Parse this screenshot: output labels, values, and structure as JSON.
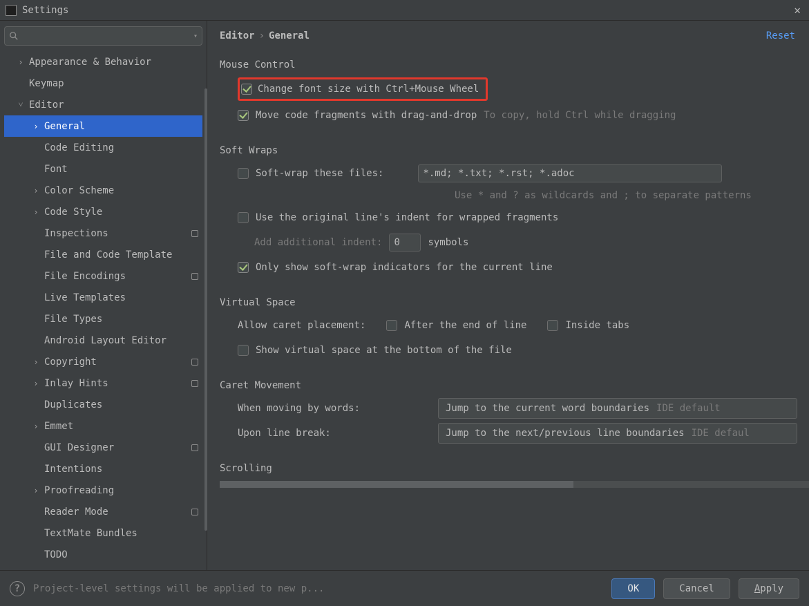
{
  "window": {
    "title": "Settings"
  },
  "search": {
    "placeholder": ""
  },
  "sidebar": {
    "items": [
      {
        "label": "Appearance & Behavior",
        "indent": 0,
        "chevron": "right",
        "badge": false
      },
      {
        "label": "Keymap",
        "indent": 0,
        "chevron": "",
        "badge": false
      },
      {
        "label": "Editor",
        "indent": 0,
        "chevron": "down",
        "badge": false
      },
      {
        "label": "General",
        "indent": 1,
        "chevron": "right",
        "badge": false,
        "selected": true
      },
      {
        "label": "Code Editing",
        "indent": 1,
        "chevron": "",
        "badge": false
      },
      {
        "label": "Font",
        "indent": 1,
        "chevron": "",
        "badge": false
      },
      {
        "label": "Color Scheme",
        "indent": 1,
        "chevron": "right",
        "badge": false
      },
      {
        "label": "Code Style",
        "indent": 1,
        "chevron": "right",
        "badge": false
      },
      {
        "label": "Inspections",
        "indent": 1,
        "chevron": "",
        "badge": true
      },
      {
        "label": "File and Code Template",
        "indent": 1,
        "chevron": "",
        "badge": false
      },
      {
        "label": "File Encodings",
        "indent": 1,
        "chevron": "",
        "badge": true
      },
      {
        "label": "Live Templates",
        "indent": 1,
        "chevron": "",
        "badge": false
      },
      {
        "label": "File Types",
        "indent": 1,
        "chevron": "",
        "badge": false
      },
      {
        "label": "Android Layout Editor",
        "indent": 1,
        "chevron": "",
        "badge": false
      },
      {
        "label": "Copyright",
        "indent": 1,
        "chevron": "right",
        "badge": true
      },
      {
        "label": "Inlay Hints",
        "indent": 1,
        "chevron": "right",
        "badge": true
      },
      {
        "label": "Duplicates",
        "indent": 1,
        "chevron": "",
        "badge": false
      },
      {
        "label": "Emmet",
        "indent": 1,
        "chevron": "right",
        "badge": false
      },
      {
        "label": "GUI Designer",
        "indent": 1,
        "chevron": "",
        "badge": true
      },
      {
        "label": "Intentions",
        "indent": 1,
        "chevron": "",
        "badge": false
      },
      {
        "label": "Proofreading",
        "indent": 1,
        "chevron": "right",
        "badge": false
      },
      {
        "label": "Reader Mode",
        "indent": 1,
        "chevron": "",
        "badge": true
      },
      {
        "label": "TextMate Bundles",
        "indent": 1,
        "chevron": "",
        "badge": false
      },
      {
        "label": "TODO",
        "indent": 1,
        "chevron": "",
        "badge": false
      }
    ]
  },
  "breadcrumb": {
    "root": "Editor",
    "leaf": "General",
    "reset": "Reset"
  },
  "mouse": {
    "title": "Mouse Control",
    "opt1": "Change font size with Ctrl+Mouse Wheel",
    "opt2": "Move code fragments with drag-and-drop",
    "opt2hint": "To copy, hold Ctrl while dragging"
  },
  "softwraps": {
    "title": "Soft Wraps",
    "opt1": "Soft-wrap these files:",
    "input1": "*.md; *.txt; *.rst; *.adoc",
    "hint1": "Use * and ? as wildcards and ; to separate patterns",
    "opt2": "Use the original line's indent for wrapped fragments",
    "indentLabel": "Add additional indent:",
    "indentVal": "0",
    "indentSuffix": "symbols",
    "opt3": "Only show soft-wrap indicators for the current line"
  },
  "virtual": {
    "title": "Virtual Space",
    "caretLabel": "Allow caret placement:",
    "caretOpt1": "After the end of line",
    "caretOpt2": "Inside tabs",
    "opt2": "Show virtual space at the bottom of the file"
  },
  "caret": {
    "title": "Caret Movement",
    "row1Label": "When moving by words:",
    "row1Val": "Jump to the current word boundaries",
    "row1Suffix": "IDE default",
    "row2Label": "Upon line break:",
    "row2Val": "Jump to the next/previous line boundaries",
    "row2Suffix": "IDE defaul"
  },
  "scrolling": {
    "title": "Scrolling"
  },
  "footer": {
    "msg": "Project-level settings will be applied to new p...",
    "ok": "OK",
    "cancel": "Cancel",
    "apply_u": "A",
    "apply_rest": "pply"
  }
}
